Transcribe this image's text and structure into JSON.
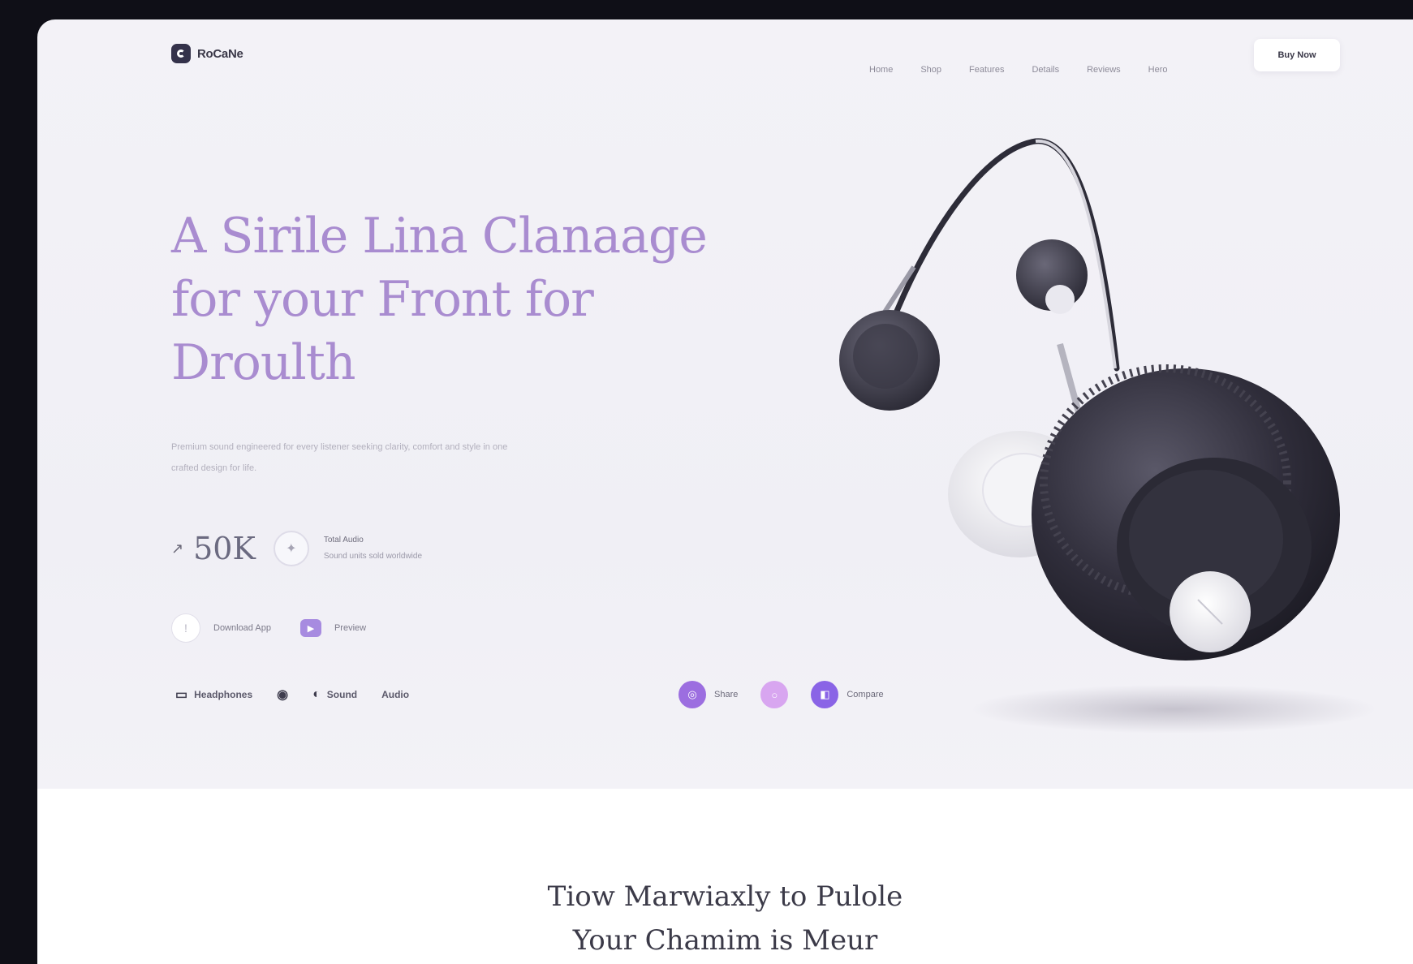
{
  "brand": {
    "name": "RoCaNe"
  },
  "nav": {
    "links": [
      "Home",
      "Shop",
      "Features",
      "Details",
      "Reviews",
      "Hero"
    ],
    "cta_label": "Buy Now"
  },
  "hero": {
    "title_lines": [
      "A Sirile Lina Clanaage",
      "for your Front for",
      "Droulth"
    ],
    "description": "Premium sound engineered for every listener seeking clarity, comfort and style in one crafted design for life.",
    "stat_arrow": "↗",
    "stat_value": "50K",
    "stat_caption_title": "Total Audio",
    "stat_caption_sub": "Sound units sold worldwide",
    "meta_primary_label": "Download App",
    "meta_secondary_label": "Preview"
  },
  "brands": [
    "Headphones",
    "",
    "Sound",
    "Audio"
  ],
  "chips": [
    {
      "label": "Share",
      "style": "purple"
    },
    {
      "label": "",
      "style": "light"
    },
    {
      "label": "Compare",
      "style": "blue"
    }
  ],
  "section2": {
    "title_lines": [
      "Tiow Marwiaxly to Pulole",
      "Your Chamim is Meur"
    ]
  },
  "colors": {
    "hero_title": "#a98cd0",
    "accent": "#9c6ee0",
    "background": "#f3f2f7",
    "frame_outer": "#0f0f17",
    "product_dark": "#2f2d3a"
  },
  "icons": [
    "logo-icon",
    "arrow-up-right-icon",
    "badge-icon",
    "info-icon",
    "app-icon",
    "brand-icon",
    "share-icon",
    "compare-icon"
  ]
}
